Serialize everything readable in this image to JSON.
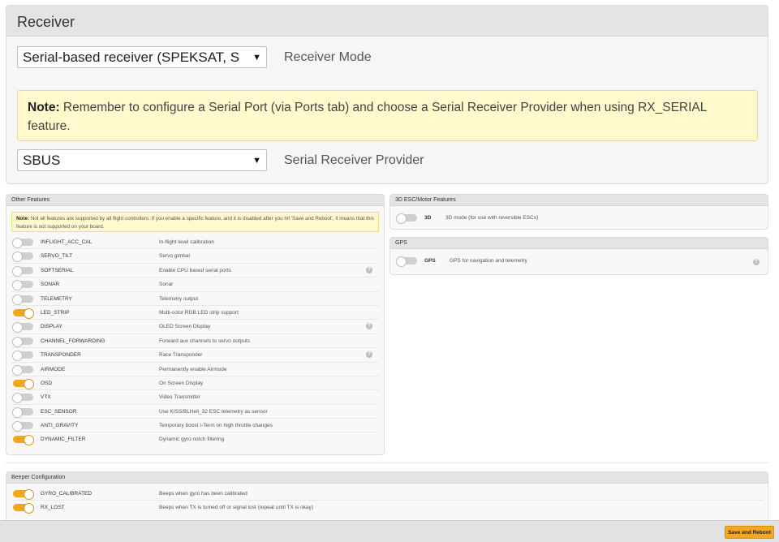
{
  "receiver": {
    "title": "Receiver",
    "mode_value": "Serial-based receiver (SPEKSAT, S",
    "mode_label": "Receiver Mode",
    "note_bold": "Note:",
    "note_text": " Remember to configure a Serial Port (via Ports tab) and choose a Serial Receiver Provider when using RX_SERIAL feature.",
    "provider_value": "SBUS",
    "provider_label": "Serial Receiver Provider"
  },
  "other_features": {
    "title": "Other Features",
    "note_bold": "Note:",
    "note_text": " Not all features are supported by all flight controllers. If you enable a specific feature, and it is disabled after you hit 'Save and Reboot', it means that this feature is not supported on your board.",
    "items": [
      {
        "name": "INFLIGHT_ACC_CAL",
        "desc": "In-flight level calibration",
        "on": false,
        "help": false
      },
      {
        "name": "SERVO_TILT",
        "desc": "Servo gimbal",
        "on": false,
        "help": false
      },
      {
        "name": "SOFTSERIAL",
        "desc": "Enable CPU based serial ports",
        "on": false,
        "help": true
      },
      {
        "name": "SONAR",
        "desc": "Sonar",
        "on": false,
        "help": false
      },
      {
        "name": "TELEMETRY",
        "desc": "Telemetry output",
        "on": false,
        "help": false
      },
      {
        "name": "LED_STRIP",
        "desc": "Multi-color RGB LED strip support",
        "on": true,
        "help": false
      },
      {
        "name": "DISPLAY",
        "desc": "OLED Screen Display",
        "on": false,
        "help": true
      },
      {
        "name": "CHANNEL_FORWARDING",
        "desc": "Forward aux channels to servo outputs",
        "on": false,
        "help": false
      },
      {
        "name": "TRANSPONDER",
        "desc": "Race Transponder",
        "on": false,
        "help": true
      },
      {
        "name": "AIRMODE",
        "desc": "Permanently enable Airmode",
        "on": false,
        "help": false
      },
      {
        "name": "OSD",
        "desc": "On Screen Display",
        "on": true,
        "help": false
      },
      {
        "name": "VTX",
        "desc": "Video Transmitter",
        "on": false,
        "help": false
      },
      {
        "name": "ESC_SENSOR",
        "desc": "Use KISS/BLHeli_32 ESC telemetry as sensor",
        "on": false,
        "help": false
      },
      {
        "name": "ANTI_GRAVITY",
        "desc": "Temporary boost I-Term on high throttle changes",
        "on": false,
        "help": false
      },
      {
        "name": "DYNAMIC_FILTER",
        "desc": "Dynamic gyro notch filtering",
        "on": true,
        "help": false
      }
    ]
  },
  "esc_features": {
    "title": "3D ESC/Motor Features",
    "name": "3D",
    "desc": "3D mode (for use with reversible ESCs)",
    "on": false
  },
  "gps": {
    "title": "GPS",
    "name": "GPS",
    "desc": "GPS for navigation and telemetry",
    "on": false
  },
  "beeper": {
    "title": "Beeper Configuration",
    "items": [
      {
        "name": "GYRO_CALIBRATED",
        "desc": "Beeps when gyro has been calibrated",
        "on": true
      },
      {
        "name": "RX_LOST",
        "desc": "Beeps when TX is turned off or signal lost (repeat until TX is okay)",
        "on": true
      }
    ]
  },
  "footer": {
    "save_label": "Save and Reboot"
  },
  "colors": {
    "toggle_on": "#f0a61c",
    "note_bg": "#fff9cd",
    "header_bg": "#e4e4e4"
  }
}
